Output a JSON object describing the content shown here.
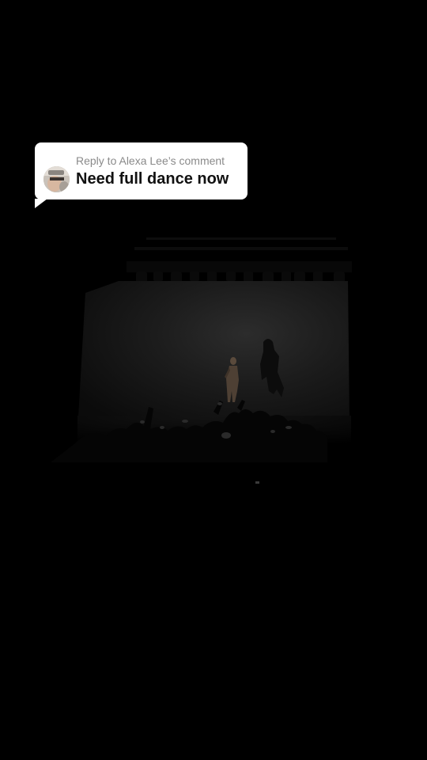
{
  "reply": {
    "label": "Reply to Alexa Lee’s comment",
    "text": "Need full dance now"
  },
  "video": {
    "scene": "concert-stage-performer"
  },
  "colors": {
    "background": "#000000",
    "bubble": "#ffffff",
    "reply_text": "#111111",
    "reply_label": "#8a8a8a"
  },
  "icons": {
    "avatar": "commenter-avatar"
  }
}
